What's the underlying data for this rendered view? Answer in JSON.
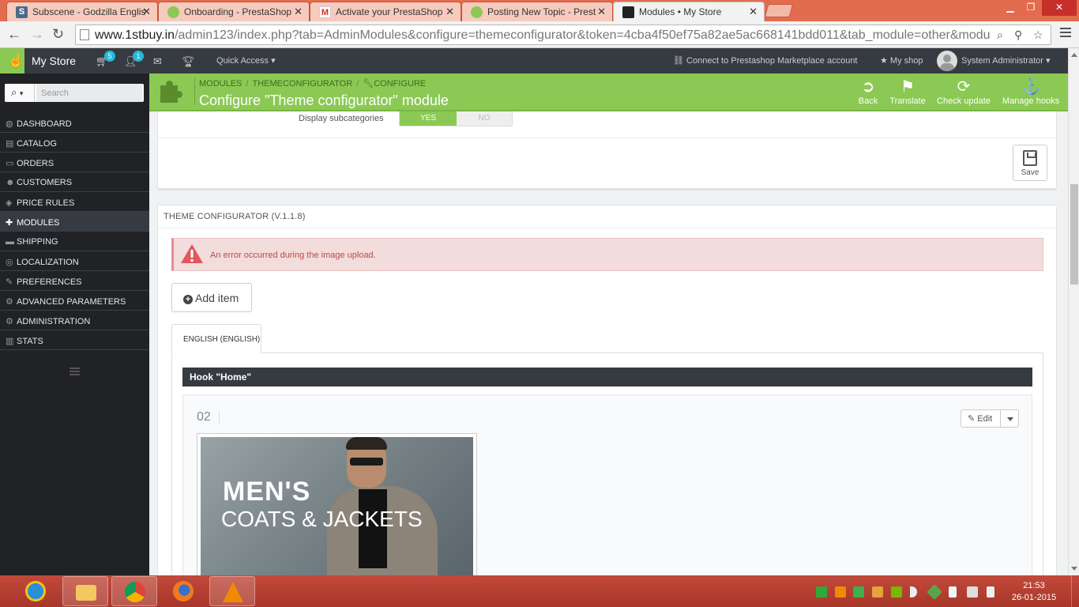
{
  "browser": {
    "tabs": [
      {
        "title": "Subscene - Godzilla Englis",
        "icon": "subscene-favicon"
      },
      {
        "title": "Onboarding - PrestaShop",
        "icon": "prestashop-favicon"
      },
      {
        "title": "Activate your PrestaShop",
        "icon": "gmail-favicon"
      },
      {
        "title": "Posting New Topic - Prest",
        "icon": "prestashop-favicon"
      },
      {
        "title": "Modules • My Store",
        "icon": "store-favicon",
        "active": true
      }
    ],
    "url_host": "www.1stbuy.in",
    "url_path": "/admin123/index.php?tab=AdminModules&configure=themeconfigurator&token=4cba4f50ef75a82ae5ac668141bdd011&tab_module=other&modu"
  },
  "header": {
    "store_name": "My Store",
    "orders_badge": "5",
    "customers_badge": "1",
    "quick_access": "Quick Access",
    "connect": "Connect to Prestashop Marketplace account",
    "my_shop": "My shop",
    "user": "System Administrator"
  },
  "sidebar": {
    "search_placeholder": "Search",
    "items": [
      {
        "label": "DASHBOARD",
        "icon": "dashboard-icon"
      },
      {
        "label": "CATALOG",
        "icon": "book-icon"
      },
      {
        "label": "ORDERS",
        "icon": "credit-card-icon"
      },
      {
        "label": "CUSTOMERS",
        "icon": "users-icon"
      },
      {
        "label": "PRICE RULES",
        "icon": "tag-icon"
      },
      {
        "label": "MODULES",
        "icon": "puzzle-icon",
        "active": true
      },
      {
        "label": "SHIPPING",
        "icon": "truck-icon"
      },
      {
        "label": "LOCALIZATION",
        "icon": "globe-icon"
      },
      {
        "label": "PREFERENCES",
        "icon": "wrench-icon"
      },
      {
        "label": "ADVANCED PARAMETERS",
        "icon": "cogs-icon"
      },
      {
        "label": "ADMINISTRATION",
        "icon": "gear-icon"
      },
      {
        "label": "STATS",
        "icon": "bar-chart-icon"
      }
    ]
  },
  "toolbar": {
    "breadcrumb": [
      "MODULES",
      "THEMECONFIGURATOR",
      "CONFIGURE"
    ],
    "title": "Configure \"Theme configurator\" module",
    "buttons": {
      "back": "Back",
      "translate": "Translate",
      "check_update": "Check update",
      "manage_hooks": "Manage hooks"
    }
  },
  "settings_panel": {
    "subcategories_label": "Display subcategories",
    "yes": "YES",
    "no": "NO",
    "save": "Save"
  },
  "configurator": {
    "heading": "THEME CONFIGURATOR (V.1.1.8)",
    "error": "An error occurred during the image upload.",
    "add_item": "Add item",
    "language_tab": "ENGLISH (ENGLISH)",
    "hook_title": "Hook \"Home\"",
    "item_number": "02",
    "edit": "Edit",
    "banner_line1": "MEN'S",
    "banner_line2": "COATS & JACKETS"
  },
  "taskbar": {
    "time": "21:53",
    "date": "26-01-2015"
  },
  "colors": {
    "accent_green": "#8bc954",
    "header_dark": "#363a41",
    "sidebar_dark": "#202226",
    "badge_blue": "#25b9d7",
    "error_text": "#b94a48",
    "chrome_tabbar": "#e46c4e"
  }
}
